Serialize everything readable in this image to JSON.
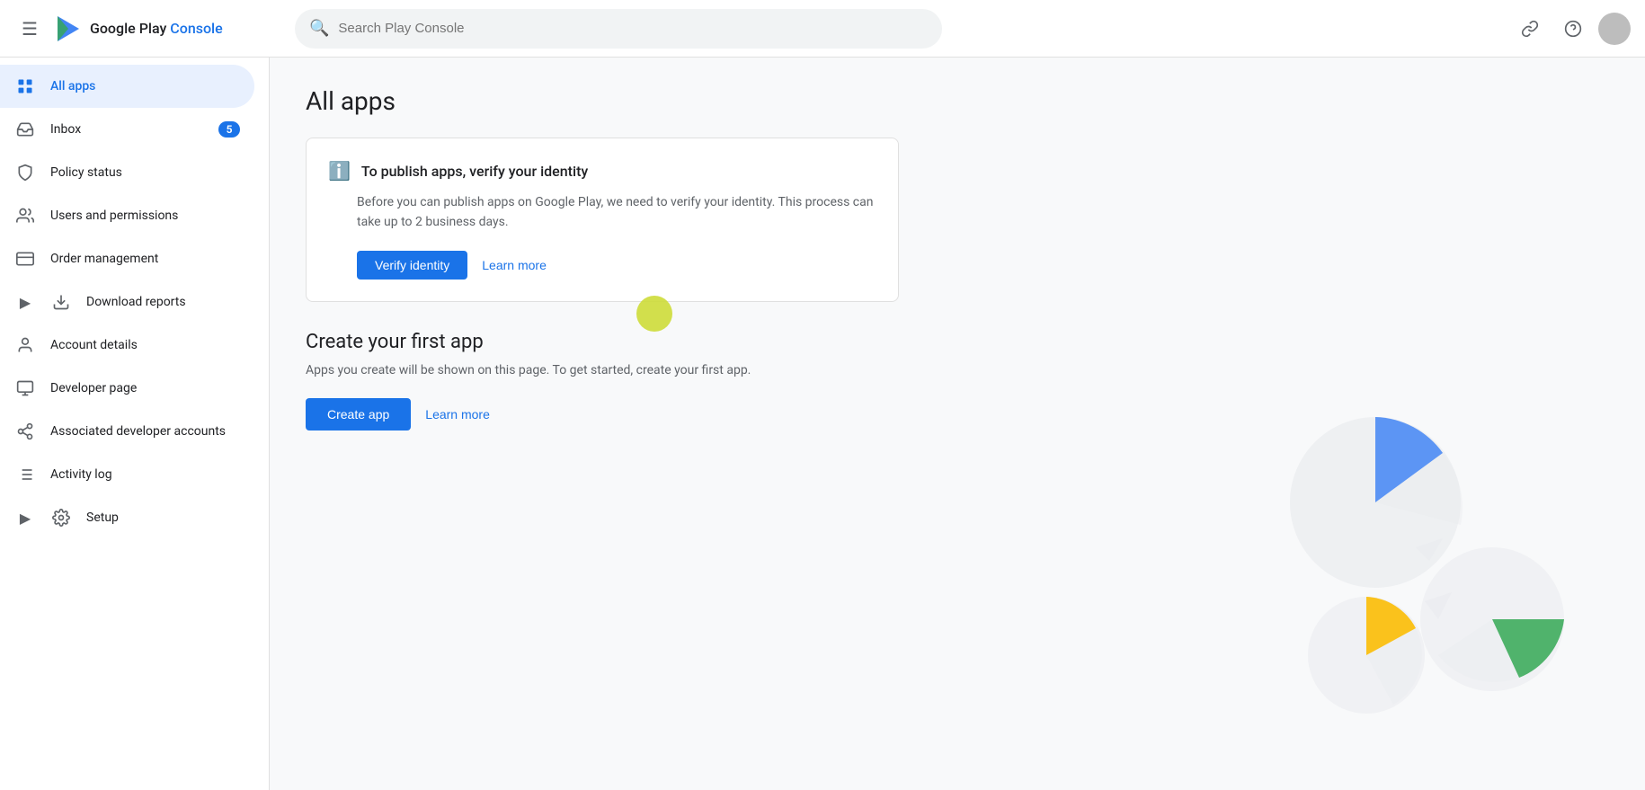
{
  "header": {
    "hamburger_label": "☰",
    "logo_text_normal": "Google Play ",
    "logo_text_accent": "Console",
    "search_placeholder": "Search Play Console",
    "link_icon": "🔗",
    "help_icon": "?",
    "title": "Google Play Console"
  },
  "sidebar": {
    "items": [
      {
        "id": "all-apps",
        "label": "All apps",
        "icon": "grid",
        "active": true,
        "badge": null,
        "expandable": false
      },
      {
        "id": "inbox",
        "label": "Inbox",
        "icon": "inbox",
        "active": false,
        "badge": "5",
        "expandable": false
      },
      {
        "id": "policy-status",
        "label": "Policy status",
        "icon": "shield",
        "active": false,
        "badge": null,
        "expandable": false
      },
      {
        "id": "users-permissions",
        "label": "Users and permissions",
        "icon": "people",
        "active": false,
        "badge": null,
        "expandable": false
      },
      {
        "id": "order-management",
        "label": "Order management",
        "icon": "card",
        "active": false,
        "badge": null,
        "expandable": false
      },
      {
        "id": "download-reports",
        "label": "Download reports",
        "icon": "download",
        "active": false,
        "badge": null,
        "expandable": true
      },
      {
        "id": "account-details",
        "label": "Account details",
        "icon": "person",
        "active": false,
        "badge": null,
        "expandable": false
      },
      {
        "id": "developer-page",
        "label": "Developer page",
        "icon": "browser",
        "active": false,
        "badge": null,
        "expandable": false
      },
      {
        "id": "associated-developer",
        "label": "Associated developer accounts",
        "icon": "link-people",
        "active": false,
        "badge": null,
        "expandable": false
      },
      {
        "id": "activity-log",
        "label": "Activity log",
        "icon": "list",
        "active": false,
        "badge": null,
        "expandable": false
      },
      {
        "id": "setup",
        "label": "Setup",
        "icon": "gear",
        "active": false,
        "badge": null,
        "expandable": true
      }
    ]
  },
  "main": {
    "page_title": "All apps",
    "alert": {
      "icon": "ℹ",
      "title": "To publish apps, verify your identity",
      "body": "Before you can publish apps on Google Play, we need to verify your identity. This process can take up to 2 business days.",
      "verify_btn": "Verify identity",
      "learn_more_link": "Learn more"
    },
    "create": {
      "title": "Create your first app",
      "description": "Apps you create will be shown on this page. To get started, create your first app.",
      "create_btn": "Create app",
      "learn_more_link": "Learn more"
    }
  }
}
